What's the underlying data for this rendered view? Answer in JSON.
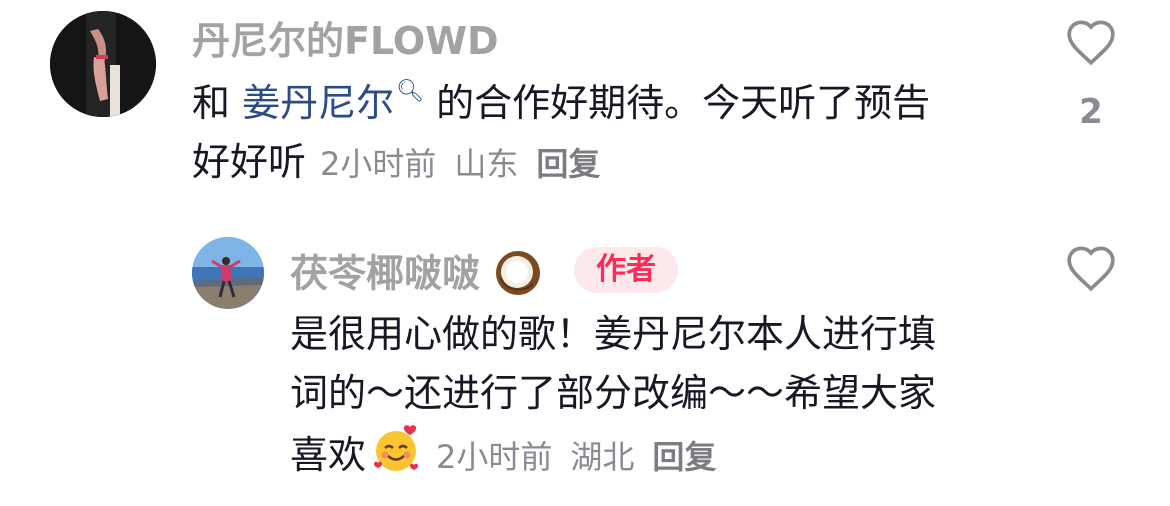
{
  "comments": [
    {
      "username": "丹尼尔的FLOWD",
      "text_before": "和 ",
      "mention": "姜丹尼尔",
      "text_line1_after": " 的合作好期待。今天听了预告",
      "text_line2": "好好听",
      "time": "2小时前",
      "location": "山东",
      "reply_label": "回复",
      "like_count": "2",
      "liked": false
    }
  ],
  "reply": {
    "username": "茯苓椰啵啵",
    "username_emoji": "coconut",
    "badge": "作者",
    "lines": [
      "是很用心做的歌！姜丹尼尔本人进行填",
      "词的～还进行了部分改编～～希望大家",
      "喜欢"
    ],
    "text_emoji": "smiling-face-with-hearts",
    "time": "2小时前",
    "location": "湖北",
    "reply_label": "回复",
    "like_count": "",
    "liked": false
  },
  "colors": {
    "username": "#a2a2a2",
    "text": "#161823",
    "mention": "#2b4c84",
    "meta": "#8a8b91",
    "badge_bg": "#fde8ec",
    "badge_text": "#fe2c55"
  }
}
